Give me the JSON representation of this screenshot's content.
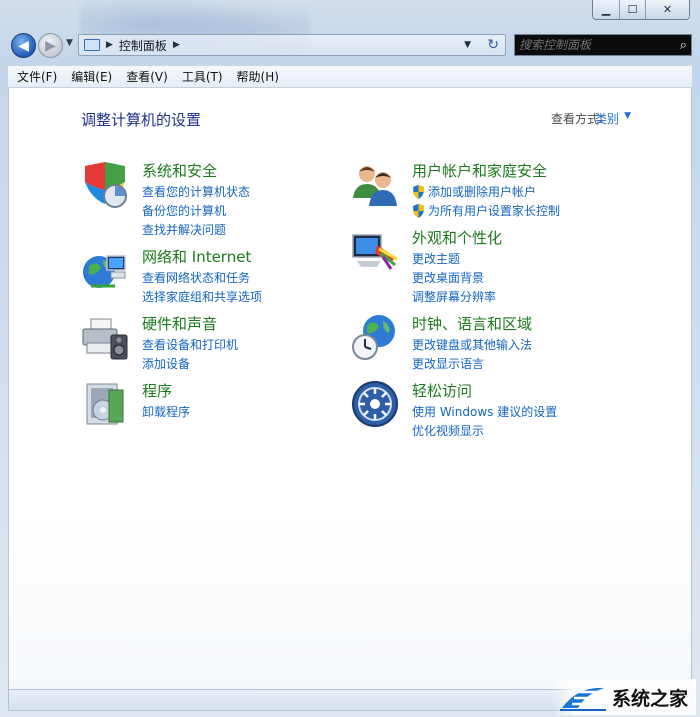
{
  "nav": {
    "breadcrumb": "控制面板",
    "search_placeholder": "搜索控制面板"
  },
  "menu": [
    "文件(F)",
    "编辑(E)",
    "查看(V)",
    "工具(T)",
    "帮助(H)"
  ],
  "page": {
    "title": "调整计算机的设置",
    "view_by_label": "查看方式:",
    "view_by_value": "类别"
  },
  "categories": [
    {
      "title": "系统和安全",
      "links": [
        "查看您的计算机状态",
        "备份您的计算机",
        "查找并解决问题"
      ]
    },
    {
      "title": "网络和 Internet",
      "links": [
        "查看网络状态和任务",
        "选择家庭组和共享选项"
      ]
    },
    {
      "title": "硬件和声音",
      "links": [
        "查看设备和打印机",
        "添加设备"
      ]
    },
    {
      "title": "程序",
      "links": [
        "卸载程序"
      ]
    },
    {
      "title": "用户帐户和家庭安全",
      "links": [
        "添加或删除用户帐户",
        "为所有用户设置家长控制"
      ]
    },
    {
      "title": "外观和个性化",
      "links": [
        "更改主题",
        "更改桌面背景",
        "调整屏幕分辨率"
      ]
    },
    {
      "title": "时钟、语言和区域",
      "links": [
        "更改键盘或其他输入法",
        "更改显示语言"
      ]
    },
    {
      "title": "轻松访问",
      "links": [
        "使用 Windows 建议的设置",
        "优化视频显示"
      ]
    }
  ],
  "watermark": {
    "text": "系统之家"
  },
  "colors": {
    "category_title": "#1b7a1b",
    "link": "#1565c0",
    "page_title": "#1e3287"
  }
}
